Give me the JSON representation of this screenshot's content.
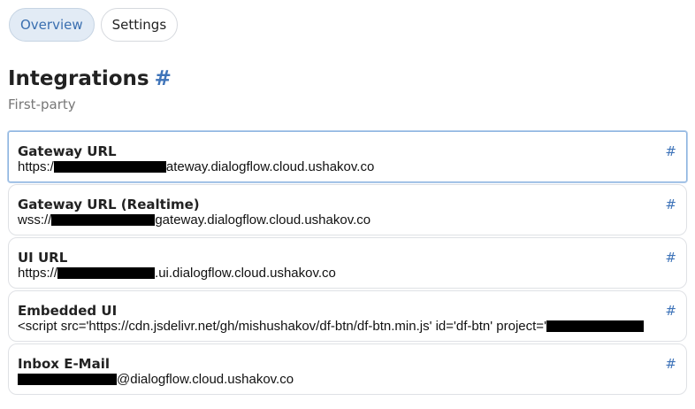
{
  "tabs": [
    {
      "label": "Overview",
      "active": true
    },
    {
      "label": "Settings",
      "active": false
    }
  ],
  "section": {
    "title": "Integrations",
    "anchor": "#",
    "subtitle": "First-party"
  },
  "integrations": [
    {
      "title": "Gateway URL",
      "anchor": "#",
      "prefix": "https:/",
      "suffix": "ateway.dialogflow.cloud.ushakov.co",
      "redacted": true
    },
    {
      "title": "Gateway URL (Realtime)",
      "anchor": "#",
      "prefix": "wss://",
      "suffix": "gateway.dialogflow.cloud.ushakov.co",
      "redacted": true
    },
    {
      "title": "UI URL",
      "anchor": "#",
      "prefix": "https://",
      "suffix": ".ui.dialogflow.cloud.ushakov.co",
      "redacted": true
    },
    {
      "title": "Embedded UI",
      "anchor": "#",
      "prefix": "<script src='https://cdn.jsdelivr.net/gh/mishushakov/df-btn/df-btn.min.js' id='df-btn' project='",
      "suffix": "",
      "redacted": true
    },
    {
      "title": "Inbox E-Mail",
      "anchor": "#",
      "prefix": "",
      "suffix": "@dialogflow.cloud.ushakov.co",
      "redacted": true
    }
  ],
  "colors": {
    "accent": "#3f74b9",
    "active_tab_bg": "#e2ebf5",
    "focus_border": "#8db4e0",
    "redaction": "#000000"
  }
}
